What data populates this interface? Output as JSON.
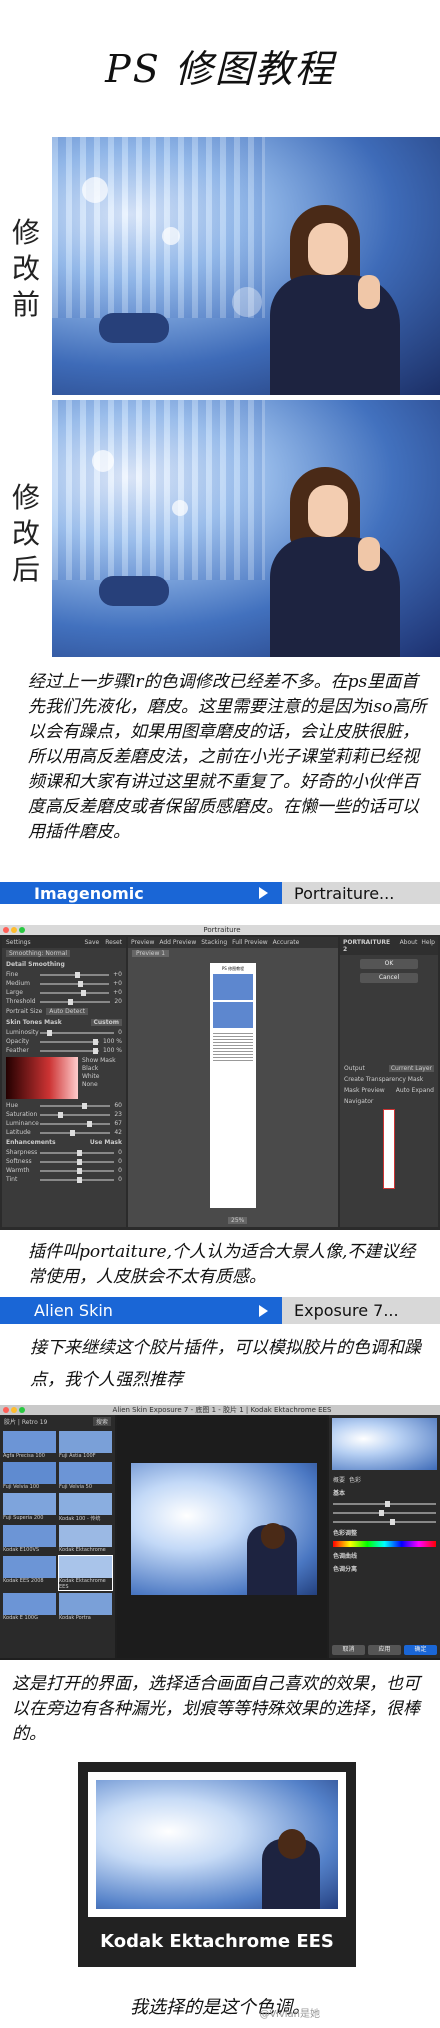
{
  "title": "PS 修图教程",
  "before_label": [
    "修",
    "改",
    "前"
  ],
  "after_label": [
    "修",
    "改",
    "后"
  ],
  "paragraph1": "经过上一步骤lr的色调修改已经差不多。在ps里面首先我们先液化，磨皮。这里需要注意的是因为iso高所以会有躁点，如果用图章磨皮的话，会让皮肤很脏，所以用高反差磨皮法，之前在小光子课堂莉莉已经视频课和大家有讲过这里就不重复了。好奇的小伙伴百度高反差磨皮或者保留质感磨皮。在懒一些的话可以用插件磨皮。",
  "menu1": {
    "left": "Imagenomic",
    "right": "Portraiture..."
  },
  "portraiture_app": {
    "window_title": "Portraiture",
    "left_panel": {
      "header": "Settings",
      "save": "Save",
      "reset": "Reset",
      "preset": "Smoothing: Normal",
      "section1": "Detail Smoothing",
      "sliders1": [
        {
          "label": "Fine",
          "value": "+0"
        },
        {
          "label": "Medium",
          "value": "+0"
        },
        {
          "label": "Large",
          "value": "+0"
        },
        {
          "label": "Threshold",
          "value": "20"
        }
      ],
      "portrait_size": "Portrait Size",
      "portrait_size_value": "Auto Detect",
      "section2": "Skin Tones Mask",
      "section2_opt": "Custom",
      "sliders2": [
        {
          "label": "Luminosity",
          "value": "0"
        },
        {
          "label": "Opacity",
          "value": "100 %"
        },
        {
          "label": "Feather",
          "value": "100 %"
        }
      ],
      "show_mask": "Show Mask",
      "mask_opts": [
        "Black",
        "White",
        "None"
      ],
      "sliders3": [
        {
          "label": "Hue",
          "value": "60"
        },
        {
          "label": "Saturation",
          "value": "23"
        },
        {
          "label": "Luminance",
          "value": "67"
        },
        {
          "label": "Latitude",
          "value": "42"
        }
      ],
      "section3": "Enhancements",
      "use_mask": "Use Mask",
      "sliders4": [
        {
          "label": "Sharpness",
          "value": "0"
        },
        {
          "label": "Softness",
          "value": "0"
        },
        {
          "label": "Warmth",
          "value": "0"
        },
        {
          "label": "Tint",
          "value": "0"
        }
      ]
    },
    "toolbar": [
      "Preview",
      "Add Preview",
      "Stacking",
      "Full Preview",
      "Accurate"
    ],
    "preview_tab": "Preview 1",
    "preview_caption": "PS 修图教程",
    "zoom": "25%",
    "right_panel": {
      "logo": "PORTRAITURE 2",
      "about": "About",
      "help": "Help",
      "ok": "OK",
      "cancel": "Cancel",
      "output": "Output",
      "output_value": "Current Layer",
      "create_mask": "Create Transparency Mask",
      "mask_preview": "Mask Preview",
      "auto_expand": "Auto Expand",
      "navigator": "Navigator"
    }
  },
  "paragraph2": "插件叫portaiture,个人认为适合大景人像,不建议经常使用，人皮肤会不太有质感。",
  "menu2": {
    "left": "Alien Skin",
    "right": "Exposure 7..."
  },
  "paragraph3": "接下来继续这个胶片插件，可以模拟胶片的色调和躁点，我个人强烈推荐",
  "exposure_app": {
    "window_title": "Alien Skin Exposure 7 - 底图 1 - 胶片 1 | Kodak Ektachrome EES",
    "search": "搜索",
    "preset_group": "胶片 | Retro 19",
    "presets": [
      "Agfa Precisa 100",
      "Fuji Astia 100F",
      "Fuji Velvia 100",
      "Fuji Velvia 50",
      "Fuji Superia 200",
      "Kodak 100 - 传统",
      "Kodak E100VS",
      "Kodak Ektachrome",
      "Kodak EES 2008",
      "Kodak Ektachrome EES",
      "Kodak E 100G",
      "Kodak Portra"
    ],
    "right_tabs": [
      "概要",
      "色彩"
    ],
    "right_sections": [
      "基本",
      "色彩调整",
      "色调曲线",
      "色调分离"
    ],
    "buttons": [
      "取消",
      "应用",
      "确定"
    ]
  },
  "paragraph4": "这是打开的界面，选择适合画面自己喜欢的效果，也可以在旁边有各种漏光，划痕等等特殊效果的选择，很棒的。",
  "film_label": "Kodak Ektachrome EES",
  "final_caption": "我选择的是这个色调。",
  "watermark": "@Vivian是她"
}
